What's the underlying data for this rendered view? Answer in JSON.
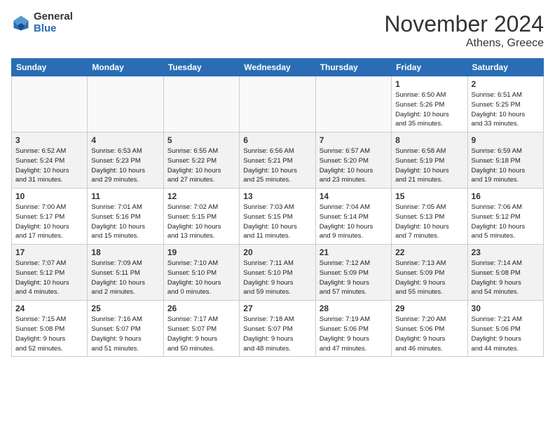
{
  "logo": {
    "general": "General",
    "blue": "Blue"
  },
  "title": "November 2024",
  "location": "Athens, Greece",
  "headers": [
    "Sunday",
    "Monday",
    "Tuesday",
    "Wednesday",
    "Thursday",
    "Friday",
    "Saturday"
  ],
  "weeks": [
    [
      {
        "day": "",
        "info": ""
      },
      {
        "day": "",
        "info": ""
      },
      {
        "day": "",
        "info": ""
      },
      {
        "day": "",
        "info": ""
      },
      {
        "day": "",
        "info": ""
      },
      {
        "day": "1",
        "info": "Sunrise: 6:50 AM\nSunset: 5:26 PM\nDaylight: 10 hours\nand 35 minutes."
      },
      {
        "day": "2",
        "info": "Sunrise: 6:51 AM\nSunset: 5:25 PM\nDaylight: 10 hours\nand 33 minutes."
      }
    ],
    [
      {
        "day": "3",
        "info": "Sunrise: 6:52 AM\nSunset: 5:24 PM\nDaylight: 10 hours\nand 31 minutes."
      },
      {
        "day": "4",
        "info": "Sunrise: 6:53 AM\nSunset: 5:23 PM\nDaylight: 10 hours\nand 29 minutes."
      },
      {
        "day": "5",
        "info": "Sunrise: 6:55 AM\nSunset: 5:22 PM\nDaylight: 10 hours\nand 27 minutes."
      },
      {
        "day": "6",
        "info": "Sunrise: 6:56 AM\nSunset: 5:21 PM\nDaylight: 10 hours\nand 25 minutes."
      },
      {
        "day": "7",
        "info": "Sunrise: 6:57 AM\nSunset: 5:20 PM\nDaylight: 10 hours\nand 23 minutes."
      },
      {
        "day": "8",
        "info": "Sunrise: 6:58 AM\nSunset: 5:19 PM\nDaylight: 10 hours\nand 21 minutes."
      },
      {
        "day": "9",
        "info": "Sunrise: 6:59 AM\nSunset: 5:18 PM\nDaylight: 10 hours\nand 19 minutes."
      }
    ],
    [
      {
        "day": "10",
        "info": "Sunrise: 7:00 AM\nSunset: 5:17 PM\nDaylight: 10 hours\nand 17 minutes."
      },
      {
        "day": "11",
        "info": "Sunrise: 7:01 AM\nSunset: 5:16 PM\nDaylight: 10 hours\nand 15 minutes."
      },
      {
        "day": "12",
        "info": "Sunrise: 7:02 AM\nSunset: 5:15 PM\nDaylight: 10 hours\nand 13 minutes."
      },
      {
        "day": "13",
        "info": "Sunrise: 7:03 AM\nSunset: 5:15 PM\nDaylight: 10 hours\nand 11 minutes."
      },
      {
        "day": "14",
        "info": "Sunrise: 7:04 AM\nSunset: 5:14 PM\nDaylight: 10 hours\nand 9 minutes."
      },
      {
        "day": "15",
        "info": "Sunrise: 7:05 AM\nSunset: 5:13 PM\nDaylight: 10 hours\nand 7 minutes."
      },
      {
        "day": "16",
        "info": "Sunrise: 7:06 AM\nSunset: 5:12 PM\nDaylight: 10 hours\nand 5 minutes."
      }
    ],
    [
      {
        "day": "17",
        "info": "Sunrise: 7:07 AM\nSunset: 5:12 PM\nDaylight: 10 hours\nand 4 minutes."
      },
      {
        "day": "18",
        "info": "Sunrise: 7:09 AM\nSunset: 5:11 PM\nDaylight: 10 hours\nand 2 minutes."
      },
      {
        "day": "19",
        "info": "Sunrise: 7:10 AM\nSunset: 5:10 PM\nDaylight: 10 hours\nand 0 minutes."
      },
      {
        "day": "20",
        "info": "Sunrise: 7:11 AM\nSunset: 5:10 PM\nDaylight: 9 hours\nand 59 minutes."
      },
      {
        "day": "21",
        "info": "Sunrise: 7:12 AM\nSunset: 5:09 PM\nDaylight: 9 hours\nand 57 minutes."
      },
      {
        "day": "22",
        "info": "Sunrise: 7:13 AM\nSunset: 5:09 PM\nDaylight: 9 hours\nand 55 minutes."
      },
      {
        "day": "23",
        "info": "Sunrise: 7:14 AM\nSunset: 5:08 PM\nDaylight: 9 hours\nand 54 minutes."
      }
    ],
    [
      {
        "day": "24",
        "info": "Sunrise: 7:15 AM\nSunset: 5:08 PM\nDaylight: 9 hours\nand 52 minutes."
      },
      {
        "day": "25",
        "info": "Sunrise: 7:16 AM\nSunset: 5:07 PM\nDaylight: 9 hours\nand 51 minutes."
      },
      {
        "day": "26",
        "info": "Sunrise: 7:17 AM\nSunset: 5:07 PM\nDaylight: 9 hours\nand 50 minutes."
      },
      {
        "day": "27",
        "info": "Sunrise: 7:18 AM\nSunset: 5:07 PM\nDaylight: 9 hours\nand 48 minutes."
      },
      {
        "day": "28",
        "info": "Sunrise: 7:19 AM\nSunset: 5:06 PM\nDaylight: 9 hours\nand 47 minutes."
      },
      {
        "day": "29",
        "info": "Sunrise: 7:20 AM\nSunset: 5:06 PM\nDaylight: 9 hours\nand 46 minutes."
      },
      {
        "day": "30",
        "info": "Sunrise: 7:21 AM\nSunset: 5:06 PM\nDaylight: 9 hours\nand 44 minutes."
      }
    ]
  ],
  "colors": {
    "header_bg": "#2a6db5",
    "header_text": "#ffffff"
  }
}
